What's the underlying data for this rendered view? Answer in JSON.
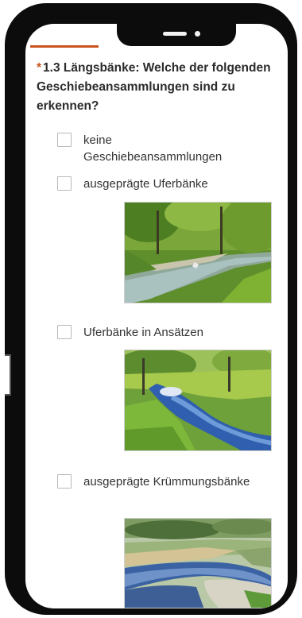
{
  "question": {
    "required_mark": "*",
    "text": "1.3 Längsbänke: Welche der folgenden Geschiebeansammlungen sind zu erkennen?"
  },
  "options": [
    {
      "label": "keine Geschiebeansammlungen",
      "has_image": false
    },
    {
      "label": "ausgeprägte Uferbänke",
      "has_image": true
    },
    {
      "label": "Uferbänke in Ansätzen",
      "has_image": true
    },
    {
      "label": "ausgeprägte Krümmungsbänke",
      "has_image": true
    }
  ],
  "colors": {
    "accent": "#c8541c",
    "text": "#2b2b2b",
    "checkbox_border": "#b8b8b8"
  }
}
